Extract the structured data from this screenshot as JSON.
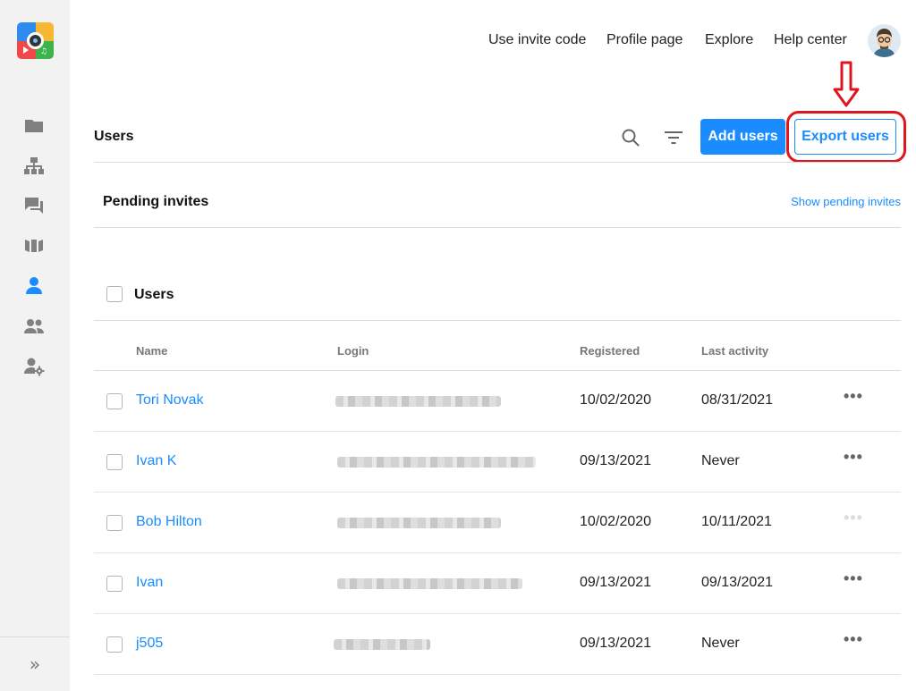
{
  "topnav": {
    "invite_code": "Use invite code",
    "profile": "Profile page",
    "explore": "Explore",
    "help": "Help center"
  },
  "sidebar": {
    "items": [
      {
        "icon": "folder-icon"
      },
      {
        "icon": "org-chart-icon"
      },
      {
        "icon": "chat-icon"
      },
      {
        "icon": "board-icon"
      },
      {
        "icon": "user-icon",
        "active": true
      },
      {
        "icon": "group-icon"
      },
      {
        "icon": "user-settings-icon"
      }
    ],
    "expand_label": "»"
  },
  "header": {
    "title": "Users",
    "add_button": "Add users",
    "export_button": "Export users"
  },
  "pending": {
    "title": "Pending invites",
    "link": "Show pending invites"
  },
  "users_section": {
    "title": "Users",
    "columns": [
      "Name",
      "Login",
      "Registered",
      "Last activity"
    ]
  },
  "rows": [
    {
      "name": "Tori Novak",
      "registered": "10/02/2020",
      "last_activity": "08/31/2021"
    },
    {
      "name": "Ivan K",
      "registered": "09/13/2021",
      "last_activity": "Never"
    },
    {
      "name": "Bob Hilton",
      "registered": "10/02/2020",
      "last_activity": "10/11/2021"
    },
    {
      "name": "Ivan",
      "registered": "09/13/2021",
      "last_activity": "09/13/2021"
    },
    {
      "name": "j505",
      "registered": "09/13/2021",
      "last_activity": "Never"
    }
  ],
  "more_label": "•••",
  "colors": {
    "accent": "#1a8cff",
    "highlight": "#e0161d",
    "sidebar_bg": "#f2f2f2"
  }
}
